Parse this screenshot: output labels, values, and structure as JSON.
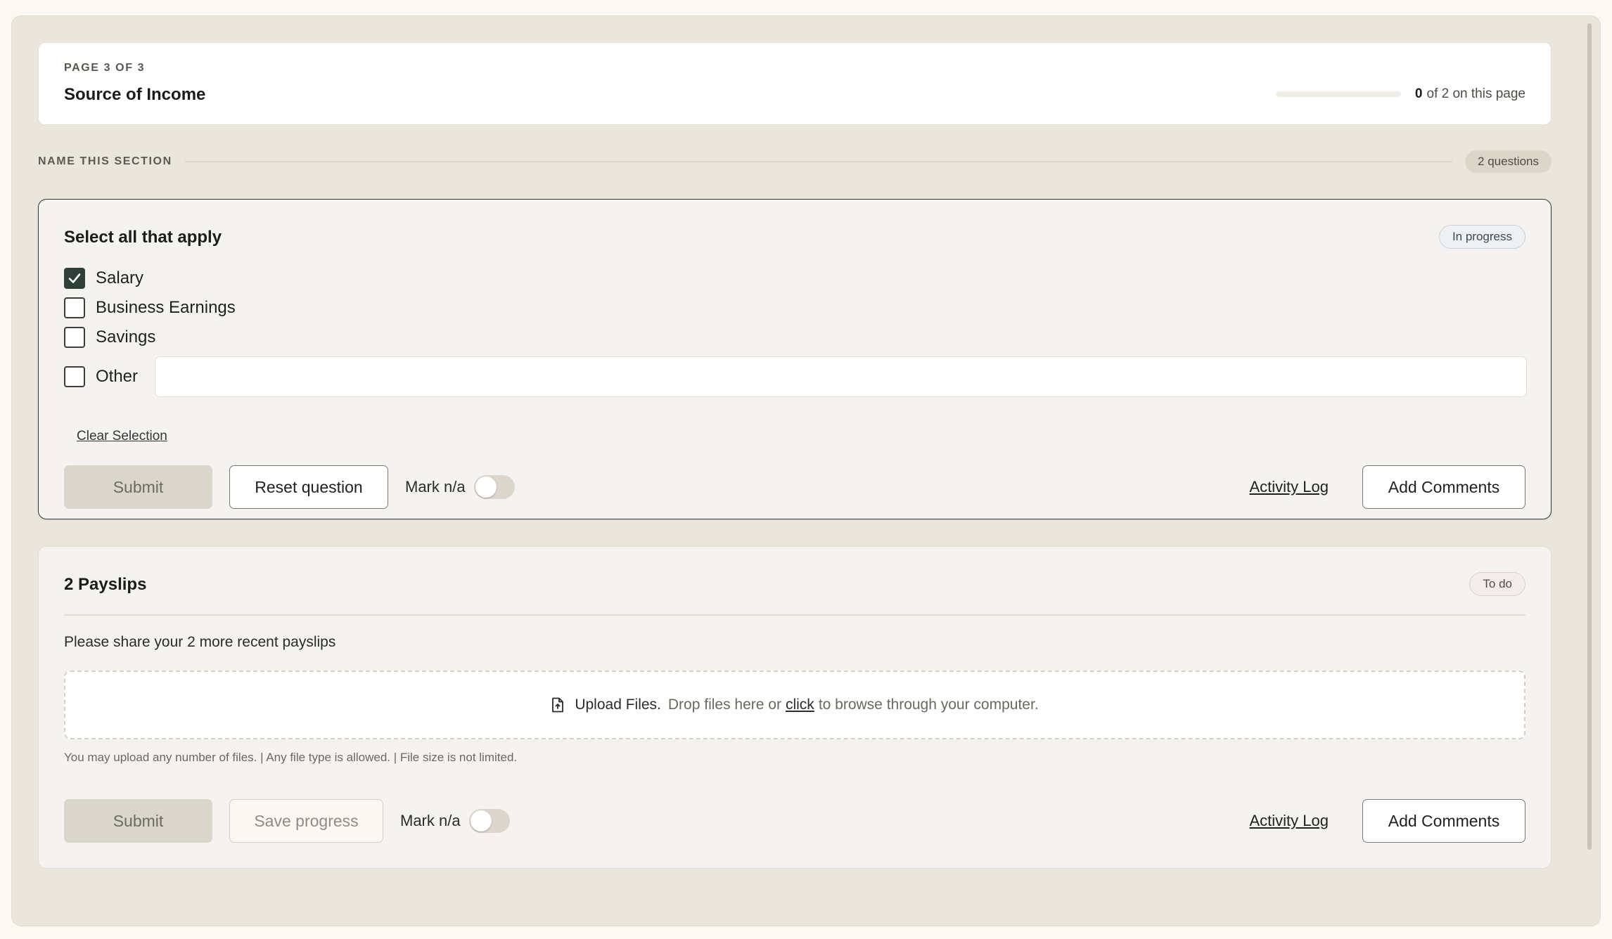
{
  "header": {
    "eyebrow": "PAGE 3 OF 3",
    "title": "Source of Income",
    "progress_count": "0",
    "progress_suffix": "of 2 on this page",
    "progress_fraction": 0
  },
  "section": {
    "label": "NAME THIS SECTION",
    "badge": "2 questions"
  },
  "question1": {
    "title": "Select all that apply",
    "status": "In progress",
    "options": [
      {
        "label": "Salary",
        "checked": true
      },
      {
        "label": "Business Earnings",
        "checked": false
      },
      {
        "label": "Savings",
        "checked": false
      },
      {
        "label": "Other",
        "checked": false
      }
    ],
    "other_value": "",
    "clear_label": "Clear Selection",
    "submit_label": "Submit",
    "reset_label": "Reset question",
    "mark_na_label": "Mark n/a",
    "activity_label": "Activity Log",
    "comments_label": "Add Comments"
  },
  "question2": {
    "title": "2 Payslips",
    "status": "To do",
    "description": "Please share your 2 more recent payslips",
    "upload_strong": "Upload Files.",
    "upload_text_before": "Drop files here or",
    "upload_link": "click",
    "upload_text_after": "to browse through your computer.",
    "upload_hint": "You may upload any number of files. | Any file type is allowed. | File size is not limited.",
    "submit_label": "Submit",
    "save_label": "Save progress",
    "mark_na_label": "Mark n/a",
    "activity_label": "Activity Log",
    "comments_label": "Add Comments"
  },
  "icons": {
    "checkmark": "check-icon",
    "file": "file-upload-icon"
  },
  "colors": {
    "accent": "#2f3f39",
    "background": "#ebe6dc",
    "card": "#f5f3ef"
  }
}
